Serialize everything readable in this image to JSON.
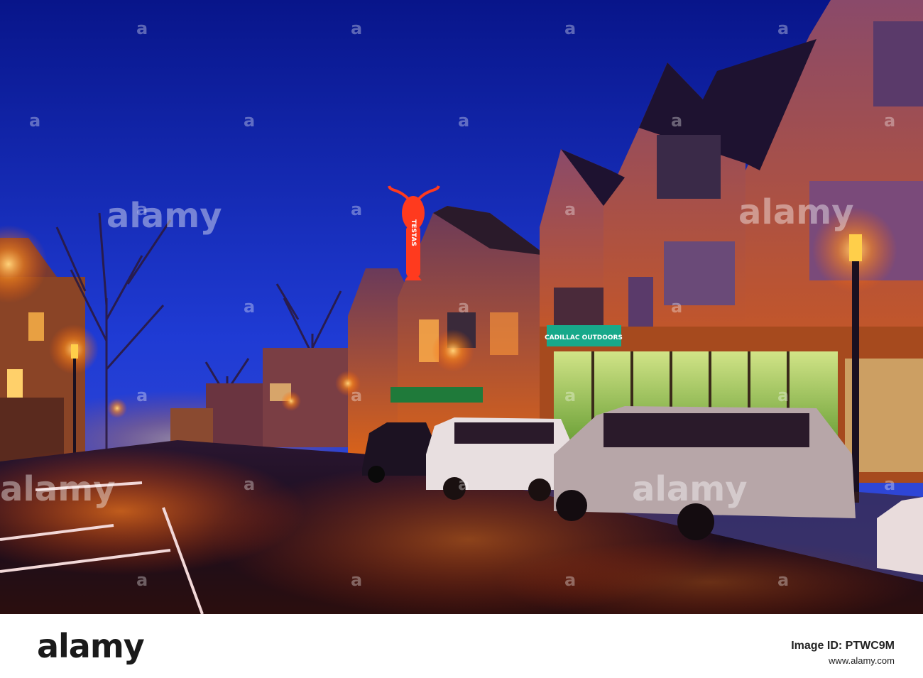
{
  "photo": {
    "description_colors": {
      "sky_top": "#0a1a8c",
      "sky_bottom": "#2f4fd9",
      "street_glow": "#ff7a1a",
      "lobster_sign": "#ff3a1e"
    },
    "signs": {
      "lobster_sign_text": "TESTAS",
      "outdoors_sign_text": "CADILLAC OUTDOORS"
    },
    "watermark_word": "alamy",
    "watermark_positions_count": 14
  },
  "footer": {
    "brand": "alamy",
    "image_id_label": "Image ID: PTWC9M",
    "url": "www.alamy.com"
  }
}
